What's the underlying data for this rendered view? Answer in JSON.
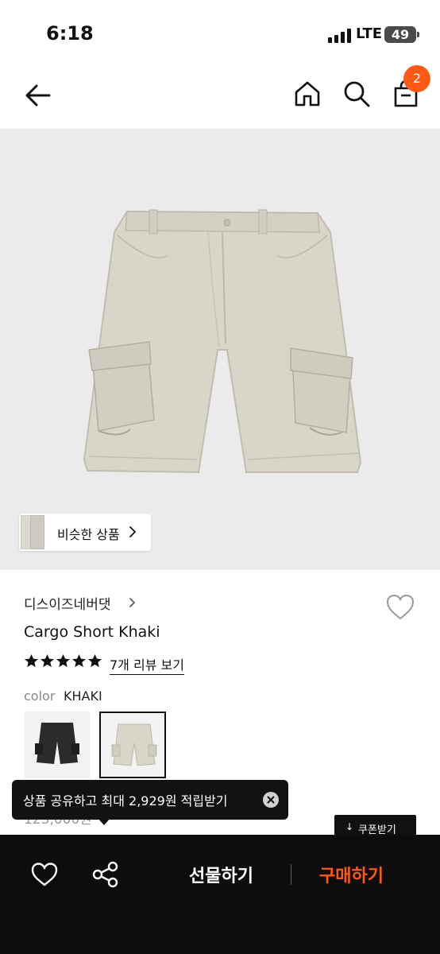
{
  "status_bar": {
    "time": "6:18",
    "network": "LTE",
    "battery": "49"
  },
  "nav": {
    "cart_count": "2"
  },
  "hero": {
    "similar_products_label": "비슷한 상품"
  },
  "product": {
    "brand": "디스이즈네버댓",
    "name": "Cargo Short Khaki",
    "rating_stars": 5,
    "review_link": "7개 리뷰 보기",
    "color_label": "color",
    "color_value": "KHAKI",
    "price_partial": "123,000원"
  },
  "swatches": [
    {
      "name": "black",
      "color": "#2b2b2b",
      "selected": false
    },
    {
      "name": "khaki",
      "color": "#d9d5c9",
      "selected": true
    }
  ],
  "tooltip": {
    "text": "상품 공유하고 최대 2,929원 적립받기"
  },
  "coupon": {
    "label": "쿠폰받기"
  },
  "bottom_bar": {
    "gift_label": "선물하기",
    "buy_label": "구매하기"
  },
  "colors": {
    "accent": "#ff5a14",
    "bar_bg": "#0d0d0d",
    "hero_bg": "#ebebeb",
    "khaki": "#d9d5c9"
  },
  "icons": [
    "back-arrow-icon",
    "home-icon",
    "search-icon",
    "shopping-bag-icon",
    "heart-icon",
    "share-icon",
    "close-icon",
    "chevron-right-icon",
    "star-icon",
    "down-arrow-icon"
  ]
}
